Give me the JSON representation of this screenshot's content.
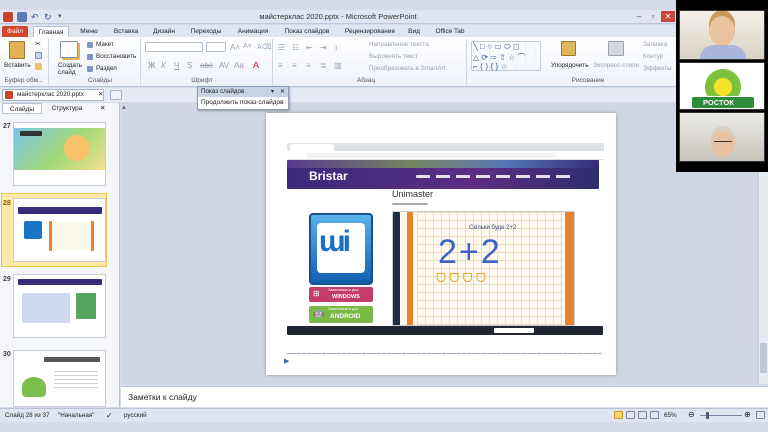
{
  "window": {
    "title": "майстерклас 2020.pptx  -  Microsoft PowerPoint",
    "minimize": "–",
    "restore": "▫",
    "close": "✕"
  },
  "tabs": [
    {
      "label": "Файл"
    },
    {
      "label": "Главная"
    },
    {
      "label": "Меню"
    },
    {
      "label": "Вставка"
    },
    {
      "label": "Дизайн"
    },
    {
      "label": "Переходы"
    },
    {
      "label": "Анимация"
    },
    {
      "label": "Показ слайдов"
    },
    {
      "label": "Рецензирование"
    },
    {
      "label": "Вид"
    },
    {
      "label": "Office Tab"
    }
  ],
  "ribbon": {
    "paste": "Вставить",
    "create_slide": "Создать слайд",
    "layout": "Макет",
    "reset": "Восстановить",
    "section": "Раздел",
    "text_direction": "Направление текста",
    "align_text": "Выровнять текст",
    "convert_smartart": "Преобразовать в SmartArt",
    "arrange": "Упорядочить",
    "quick_styles": "Экспресс-стили",
    "fill": "Заливка",
    "outline": "Контур",
    "effects": "Эффекты",
    "groups": {
      "clipboard": "Буфер обм...",
      "slides": "Слайды",
      "font": "Шрифт",
      "paragraph": "Абзац",
      "drawing": "Рисование"
    }
  },
  "doc_tab": {
    "label": "майстерклас 2020.pptx"
  },
  "panel": {
    "tab_slides": "Слайды",
    "tab_outline": "Структура",
    "thumb_numbers": [
      "27",
      "28",
      "29",
      "30"
    ]
  },
  "popup": {
    "header": "Показ слайдов",
    "item": "Продолжить показ слайдов"
  },
  "slide": {
    "site_title": "Unimaster",
    "brand": "Bristar",
    "windows_btn": "WINDOWS",
    "android_btn": "ANDROID",
    "windows_caption": "Завантажити для",
    "android_caption": "Завантажити для",
    "board_task": "Скільки буде 2+2",
    "board_expr": "2+2"
  },
  "notes": {
    "placeholder": "Заметки к слайду"
  },
  "status": {
    "slide_info": "Слайд 28 из 37",
    "theme": "\"Начальная\"",
    "language": "русский",
    "zoom": "65%"
  },
  "video": {
    "tile2_label": "РОСТОК"
  },
  "colors": {
    "file_tab": "#d2472b",
    "selected_thumb": "#fce9a8",
    "bristar_purple": "#3a2a7a",
    "windows_btn": "#c43c6a",
    "android_btn": "#79b944",
    "board_orange": "#e8822e",
    "rostok_green": "#2e8b3a"
  }
}
